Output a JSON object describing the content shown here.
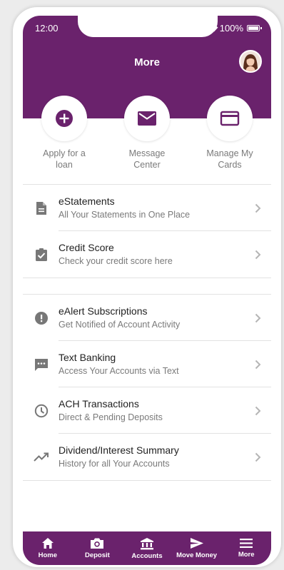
{
  "status_bar": {
    "time": "12:00",
    "battery": "100%"
  },
  "header": {
    "title": "More"
  },
  "quick_actions": [
    {
      "label_line1": "Apply for a",
      "label_line2": "loan",
      "icon": "plus-circle-icon"
    },
    {
      "label_line1": "Message",
      "label_line2": "Center",
      "icon": "envelope-icon"
    },
    {
      "label_line1": "Manage My",
      "label_line2": "Cards",
      "icon": "credit-card-icon"
    }
  ],
  "section1": [
    {
      "title": "eStatements",
      "subtitle": "All Your Statements in One Place",
      "icon": "document-icon"
    },
    {
      "title": "Credit Score",
      "subtitle": "Check your credit score here",
      "icon": "clipboard-check-icon"
    }
  ],
  "section2": [
    {
      "title": "eAlert Subscriptions",
      "subtitle": "Get Notified of Account Activity",
      "icon": "alert-icon"
    },
    {
      "title": "Text Banking",
      "subtitle": "Access Your Accounts via Text",
      "icon": "chat-icon"
    },
    {
      "title": "ACH Transactions",
      "subtitle": "Direct & Pending Deposits",
      "icon": "clock-icon"
    },
    {
      "title": "Dividend/Interest Summary",
      "subtitle": "History for all Your Accounts",
      "icon": "trending-up-icon"
    }
  ],
  "tabbar": [
    {
      "label": "Home",
      "icon": "home-icon"
    },
    {
      "label": "Deposit",
      "icon": "camera-icon"
    },
    {
      "label": "Accounts",
      "icon": "bank-icon"
    },
    {
      "label": "Move Money",
      "icon": "send-icon"
    },
    {
      "label": "More",
      "icon": "menu-icon"
    }
  ],
  "colors": {
    "brand": "#6a226c",
    "text": "#222222",
    "muted": "#7a7a7a",
    "icon": "#777777"
  }
}
